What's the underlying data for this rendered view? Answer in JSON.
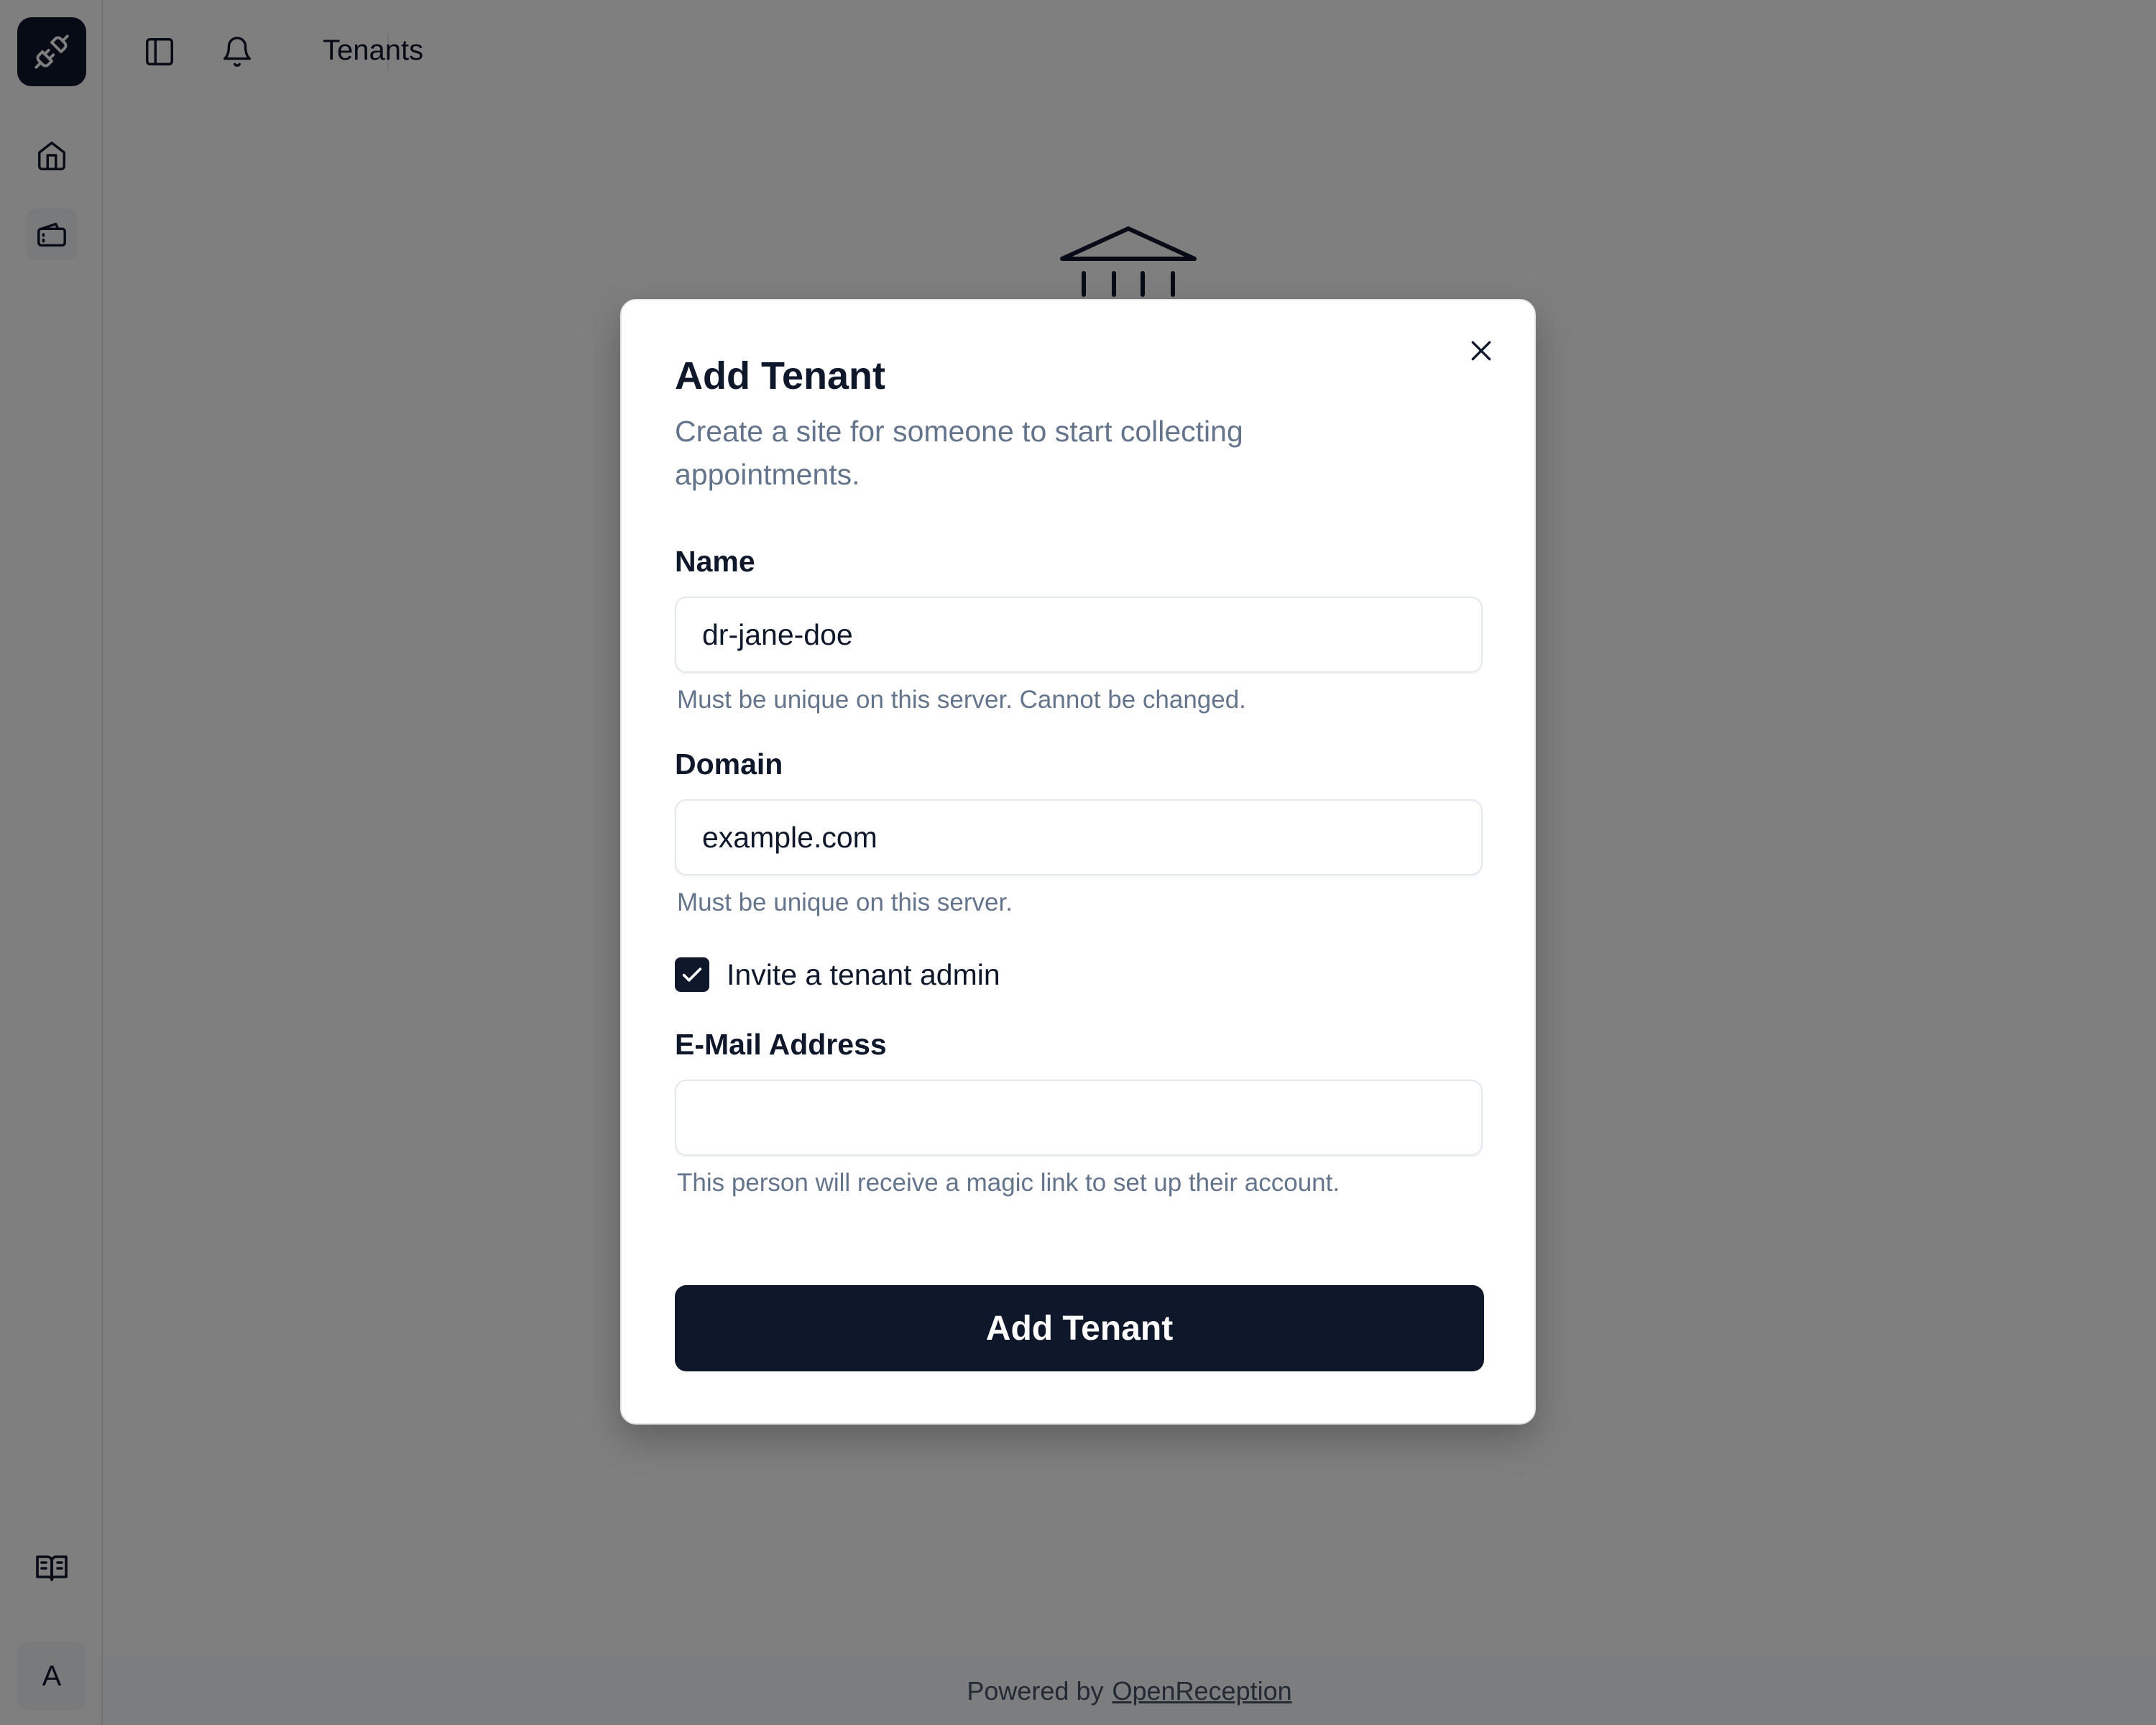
{
  "header": {
    "page_title": "Tenants"
  },
  "sidebar": {
    "logo_icon": "plug-icon",
    "items": [
      {
        "icon": "home-icon"
      },
      {
        "icon": "tickets-icon"
      }
    ],
    "docs_icon": "book-icon",
    "avatar_letter": "A"
  },
  "footer": {
    "prefix": "Powered by",
    "link": "OpenReception"
  },
  "modal": {
    "title": "Add Tenant",
    "description": "Create a site for someone to start collecting appointments.",
    "name": {
      "label": "Name",
      "value": "dr-jane-doe",
      "hint": "Must be unique on this server. Cannot be changed."
    },
    "domain": {
      "label": "Domain",
      "value": "example.com",
      "hint": "Must be unique on this server."
    },
    "invite": {
      "label": "Invite a tenant admin",
      "checked": true
    },
    "email": {
      "label": "E-Mail Address",
      "value": "",
      "hint": "This person will receive a magic link to set up their account."
    },
    "submit_label": "Add Tenant"
  },
  "colors": {
    "primary": "#0f172a",
    "muted_text": "#64748b",
    "overlay": "rgba(0,0,0,0.5)"
  }
}
